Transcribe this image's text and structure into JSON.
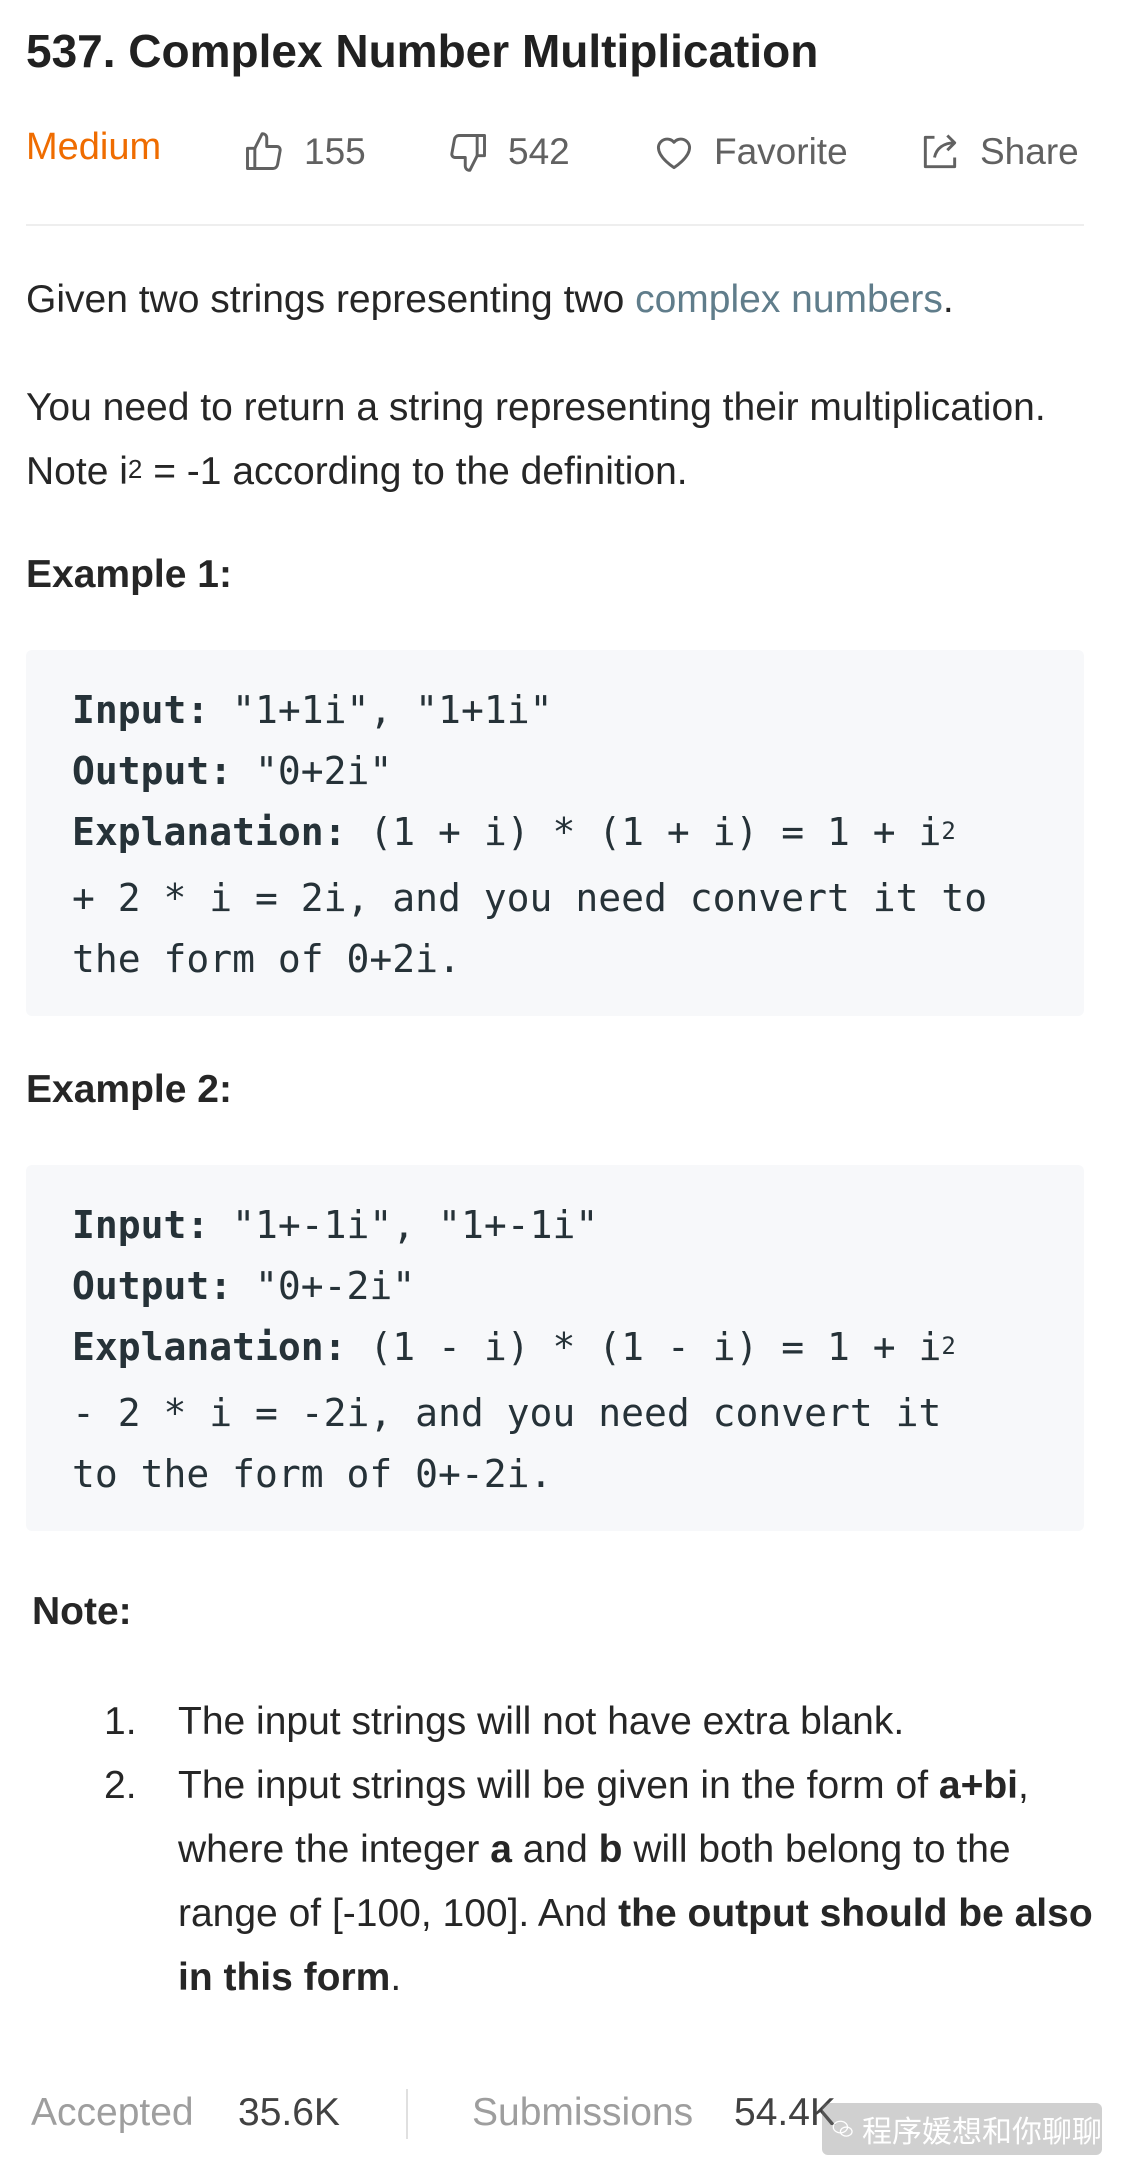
{
  "problem": {
    "title": "537. Complex Number Multiplication",
    "difficulty": "Medium",
    "likes": "155",
    "dislikes": "542",
    "favorite_label": "Favorite",
    "share_label": "Share"
  },
  "description": {
    "p1_before": "Given two strings representing two ",
    "p1_link": "complex numbers",
    "p1_after": ".",
    "p2_before": "You need to return a string representing their multiplication. Note i",
    "p2_sup": "2",
    "p2_after": " = -1 according to the definition."
  },
  "example1": {
    "heading": "Example 1:",
    "input_label": "Input:",
    "input_value": " \"1+1i\", \"1+1i\"",
    "output_label": "Output:",
    "output_value": " \"0+2i\"",
    "explanation_label": "Explanation:",
    "explanation_line1": " (1 + i) * (1 + i) = 1 + i",
    "explanation_sup": "2",
    "explanation_line2": "+ 2 * i = 2i, and you need convert it to",
    "explanation_line3": "the form of 0+2i."
  },
  "example2": {
    "heading": "Example 2:",
    "input_label": "Input:",
    "input_value": " \"1+-1i\", \"1+-1i\"",
    "output_label": "Output:",
    "output_value": " \"0+-2i\"",
    "explanation_label": "Explanation:",
    "explanation_line1": " (1 - i) * (1 - i) = 1 + i",
    "explanation_sup": "2",
    "explanation_line2": "- 2 * i = -2i, and you need convert it",
    "explanation_line3": "to the form of 0+-2i."
  },
  "note": {
    "heading": "Note:",
    "item1_num": "1.",
    "item1_text": "The input strings will not have extra blank.",
    "item2_num": "2.",
    "item2_t1": "The input strings will be given in the form of ",
    "item2_b1": "a+bi",
    "item2_t2": ", where the integer ",
    "item2_b2": "a",
    "item2_t3": " and ",
    "item2_b3": "b",
    "item2_t4": " will both belong to the range of [-100, 100]. And ",
    "item2_b4": "the output should be also in this form",
    "item2_t5": "."
  },
  "stats": {
    "accepted_label": "Accepted",
    "accepted_value": "35.6K",
    "submissions_label": "Submissions",
    "submissions_value": "54.4K"
  },
  "watermark": {
    "text": "程序媛想和你聊聊"
  },
  "colors": {
    "difficulty": "#ef6c00",
    "link": "#607d8b",
    "code_bg": "#f7f8fa"
  }
}
